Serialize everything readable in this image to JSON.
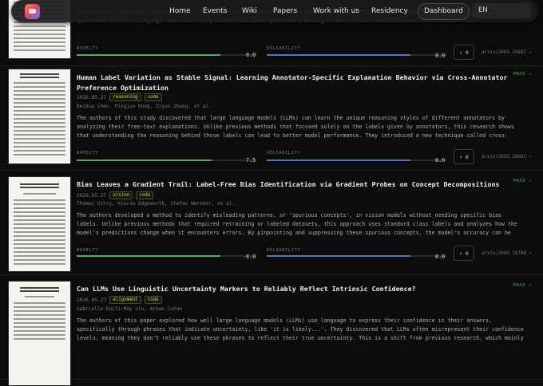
{
  "nav": {
    "links": [
      "Home",
      "Events",
      "Wiki",
      "Papers",
      "Work with us",
      "Residency",
      "Dashboard"
    ],
    "language": "EN"
  },
  "papers": [
    {
      "abstract": "perspective, language-conditioned, and action-centric). Unlike previous methods that quantize the entire model, Omega-QVLA uniformly quantizes both the language and action components to a lower precision, making it more stable and effective. This results in...",
      "novelty_label": "NOVELTY",
      "novelty": "8.0",
      "novelty_level": 0.8,
      "reliability_label": "RELIABILITY",
      "reliability": "8.0",
      "reliability_level": 0.8,
      "votes": "↑ 0",
      "arxiv": "arxiv/2605.28883 →",
      "verdict": ""
    },
    {
      "title": "Human Label Variation as Stable Signal: Learning Annotator-Specific Explanation Behavior via Cross-Annotator Preference Optimization",
      "date": "2026.05.27",
      "tags": [
        "reasoning",
        "code"
      ],
      "authors": "Beidua Chen, Pingjun Hong, Ziyun Zhang, et al.",
      "abstract": "The authors of this study discovered that large language models (LLMs) can learn the unique reasoning styles of different annotators by analyzing their free-text explanations. Unlike previous methods that focused solely on the labels given by annotators, this research shows that understanding the reasoning behind those labels can lead to better model performance. They introduced a new technique called cross-annotator preference...",
      "novelty_label": "NOVELTY",
      "novelty": "7.5",
      "novelty_level": 0.75,
      "reliability_label": "RELIABILITY",
      "reliability": "8.0",
      "reliability_level": 0.8,
      "votes": "↑ 0",
      "arxiv": "arxiv/2605.28082 →",
      "verdict": "PASS ✓"
    },
    {
      "title": "Bias Leaves a Gradient Trail: Label-Free Bias Identification via Gradient Probes on Concept Decompositions",
      "date": "2026.05.27",
      "tags": [
        "vision",
        "code"
      ],
      "authors": "Thomas Vitry, Kieran Edgeworth, Stefan Wermter, et al.",
      "abstract": "The authors developed a method to identify misleading patterns, or 'spurious concepts', in vision models without needing specific bias labels. Unlike previous methods that required retraining or labeled datasets, this approach uses standard class labels and analyzes how the model's predictions change when it encounters errors. By pinpointing and suppressing these spurious concepts, the model's accuracy can be significantly...",
      "novelty_label": "NOVELTY",
      "novelty": "8.0",
      "novelty_level": 0.8,
      "reliability_label": "RELIABILITY",
      "reliability": "8.0",
      "reliability_level": 0.8,
      "votes": "↑ 0",
      "arxiv": "arxiv/2605.28708 →",
      "verdict": "PASS ✓"
    },
    {
      "title": "Can LLMs Use Linguistic Uncertainty Markers to Reliably Reflect Intrinsic Confidence?",
      "date": "2026.05.27",
      "tags": [
        "alignment",
        "code"
      ],
      "authors": "Gabrielle Kaili-May Liu, Arman Cohan",
      "abstract": "The authors of this paper explored how well large language models (LLMs) use language to express their confidence in their answers, specifically through phrases that indicate uncertainty, like 'it is likely...'. They discovered that LLMs often misrepresent their confidence levels, meaning they don't reliably use these phrases to reflect their true uncertainty. This is a shift from previous research, which mainly focused on how LLMs...",
      "verdict": "PASS ✓"
    }
  ],
  "colors": {
    "novelty": "#45b058",
    "reliability": "#4f77d0",
    "tag_text": "#d2d84a",
    "pass": "#5fb86b"
  }
}
